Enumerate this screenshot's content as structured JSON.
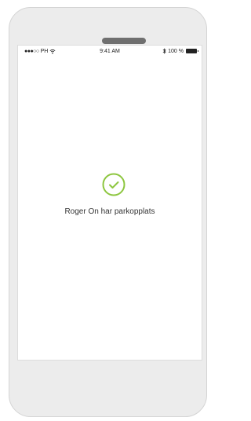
{
  "status_bar": {
    "carrier": "PH",
    "signal_dots": "●●●○○",
    "time": "9:41 AM",
    "battery_text": "100 %"
  },
  "icons": {
    "wifi": "wifi-icon",
    "bluetooth": "bluetooth-icon",
    "battery": "battery-icon",
    "success": "checkmark-circle-icon"
  },
  "colors": {
    "success_green": "#8dc63f",
    "text": "#333333"
  },
  "main": {
    "message": "Roger On har parkopplats"
  }
}
